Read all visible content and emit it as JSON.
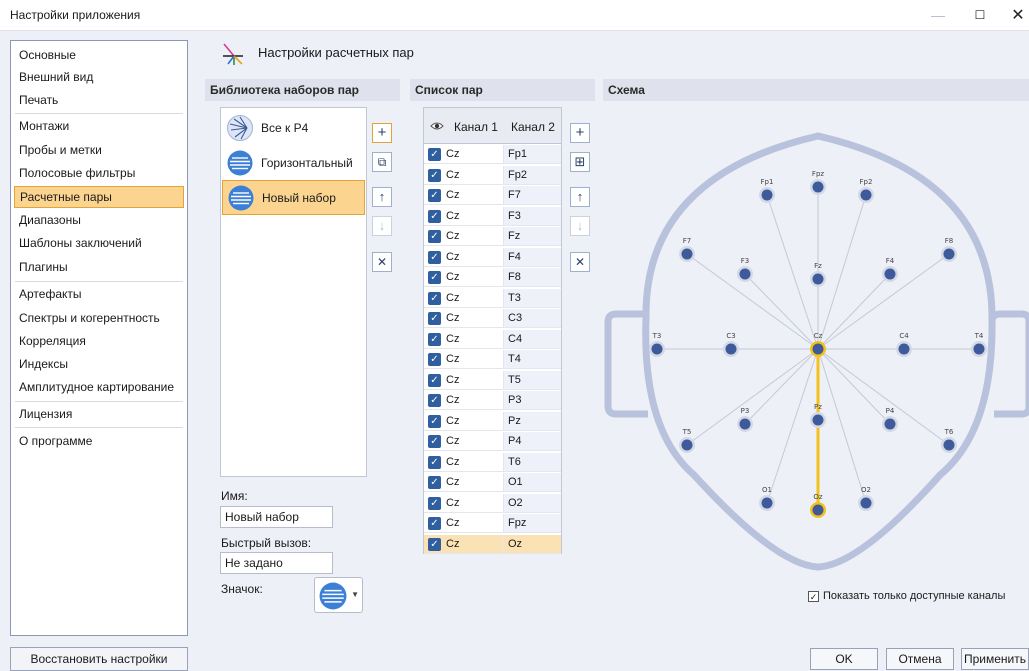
{
  "window": {
    "title": "Настройки приложения",
    "minimize": "—",
    "maximize": "☐",
    "close": "✕"
  },
  "sidebar": {
    "items": [
      {
        "label": "Основные"
      },
      {
        "label": "Внешний вид"
      },
      {
        "label": "Печать"
      },
      {
        "label": "Монтажи"
      },
      {
        "label": "Пробы и метки"
      },
      {
        "label": "Полосовые фильтры"
      },
      {
        "label": "Расчетные пары",
        "active": true
      },
      {
        "label": "Диапазоны"
      },
      {
        "label": "Шаблоны заключений"
      },
      {
        "label": "Плагины"
      },
      {
        "label": "Артефакты"
      },
      {
        "label": "Спектры и когерентность"
      },
      {
        "label": "Корреляция"
      },
      {
        "label": "Индексы"
      },
      {
        "label": "Амплитудное картирование"
      },
      {
        "label": "Лицензия"
      },
      {
        "label": "О программе"
      }
    ],
    "restore_label": "Восстановить настройки"
  },
  "page": {
    "title": "Настройки расчетных пар",
    "icon": "pairs-fan-icon"
  },
  "library": {
    "header": "Библиотека наборов пар",
    "items": [
      {
        "label": "Все к P4",
        "icon": "fan-icon"
      },
      {
        "label": "Горизонтальный",
        "icon": "stripes-icon"
      },
      {
        "label": "Новый набор",
        "icon": "stripes-icon",
        "selected": true
      }
    ],
    "tools": {
      "add": "+",
      "copy": "⧉",
      "up": "↑",
      "down": "↓",
      "delete": "✕"
    },
    "name_label": "Имя:",
    "name_value": "Новый набор",
    "hotkey_label": "Быстрый вызов:",
    "hotkey_value": "Не задано",
    "icon_label": "Значок:"
  },
  "pairs": {
    "header": "Список пар",
    "columns": {
      "ch1": "Канал 1",
      "ch2": "Канал 2"
    },
    "rows": [
      {
        "ch1": "Cz",
        "ch2": "Fp1"
      },
      {
        "ch1": "Cz",
        "ch2": "Fp2"
      },
      {
        "ch1": "Cz",
        "ch2": "F7"
      },
      {
        "ch1": "Cz",
        "ch2": "F3"
      },
      {
        "ch1": "Cz",
        "ch2": "Fz"
      },
      {
        "ch1": "Cz",
        "ch2": "F4"
      },
      {
        "ch1": "Cz",
        "ch2": "F8"
      },
      {
        "ch1": "Cz",
        "ch2": "T3"
      },
      {
        "ch1": "Cz",
        "ch2": "C3"
      },
      {
        "ch1": "Cz",
        "ch2": "C4"
      },
      {
        "ch1": "Cz",
        "ch2": "T4"
      },
      {
        "ch1": "Cz",
        "ch2": "T5"
      },
      {
        "ch1": "Cz",
        "ch2": "P3"
      },
      {
        "ch1": "Cz",
        "ch2": "Pz"
      },
      {
        "ch1": "Cz",
        "ch2": "P4"
      },
      {
        "ch1": "Cz",
        "ch2": "T6"
      },
      {
        "ch1": "Cz",
        "ch2": "O1"
      },
      {
        "ch1": "Cz",
        "ch2": "O2"
      },
      {
        "ch1": "Cz",
        "ch2": "Fpz"
      },
      {
        "ch1": "Cz",
        "ch2": "Oz",
        "selected": true
      }
    ],
    "tools": {
      "add": "+",
      "add_grid": "⊞",
      "up": "↑",
      "down": "↓",
      "delete": "✕"
    }
  },
  "scheme": {
    "header": "Схема",
    "center": "Cz",
    "highlighted": "Oz",
    "electrodes": [
      "Fp1",
      "Fpz",
      "Fp2",
      "F7",
      "F3",
      "Fz",
      "F4",
      "F8",
      "T3",
      "C3",
      "Cz",
      "C4",
      "T4",
      "T5",
      "P3",
      "Pz",
      "P4",
      "T6",
      "O1",
      "Oz",
      "O2"
    ],
    "only_available_label": "Показать только доступные каналы",
    "only_available_checked": true
  },
  "footer": {
    "ok": "OK",
    "cancel": "Отмена",
    "apply": "Применить"
  },
  "colors": {
    "accent": "#fbd58f",
    "accent_border": "#e3a23b",
    "head": "#b9c2dd",
    "electrode": "#3e5a9a",
    "highlight": "#f2c21a"
  }
}
